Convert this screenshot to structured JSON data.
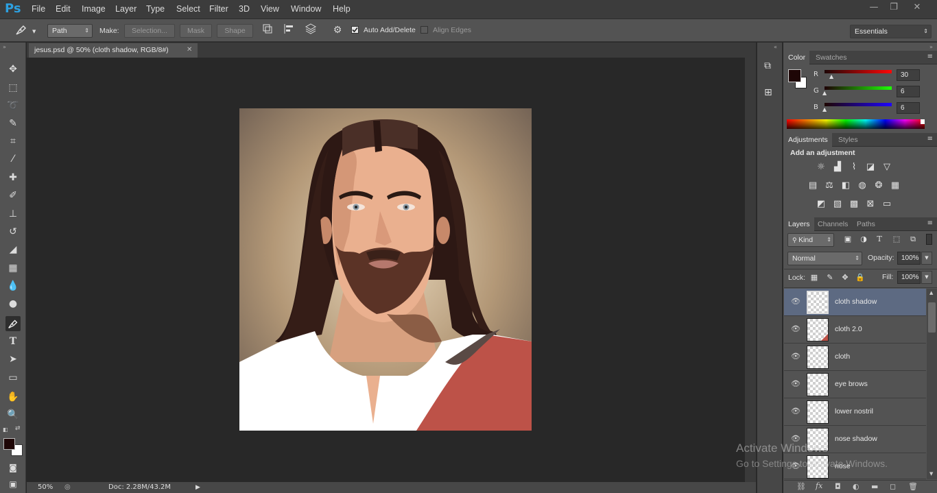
{
  "app": {
    "logo": "Ps"
  },
  "menu": [
    "File",
    "Edit",
    "Image",
    "Layer",
    "Type",
    "Select",
    "Filter",
    "3D",
    "View",
    "Window",
    "Help"
  ],
  "window_controls": {
    "minimize": "—",
    "restore": "❐",
    "close": "✕"
  },
  "options": {
    "mode": "Path",
    "make_label": "Make:",
    "selection": "Selection...",
    "mask": "Mask",
    "shape": "Shape",
    "auto_add_delete": "Auto Add/Delete",
    "align_edges": "Align Edges",
    "workspace": "Essentials"
  },
  "document": {
    "tab_title": "jesus.psd @ 50% (cloth shadow, RGB/8#)",
    "zoom": "50%",
    "doc_size": "Doc: 2.28M/43.2M"
  },
  "color_panel": {
    "tabs": [
      "Color",
      "Swatches"
    ],
    "r_label": "R",
    "g_label": "G",
    "b_label": "B",
    "r": "30",
    "g": "6",
    "b": "6",
    "foreground": "#1e0606",
    "background": "#ffffff"
  },
  "adjustments_panel": {
    "tabs": [
      "Adjustments",
      "Styles"
    ],
    "heading": "Add an adjustment"
  },
  "layers_panel": {
    "tabs": [
      "Layers",
      "Channels",
      "Paths"
    ],
    "filter_kind": "Kind",
    "blend_mode": "Normal",
    "opacity_label": "Opacity:",
    "opacity": "100%",
    "lock_label": "Lock:",
    "fill_label": "Fill:",
    "fill": "100%",
    "layers": [
      {
        "name": "cloth shadow",
        "selected": true
      },
      {
        "name": "cloth 2.0",
        "selected": false
      },
      {
        "name": "cloth",
        "selected": false
      },
      {
        "name": "eye brows",
        "selected": false
      },
      {
        "name": "lower nostril",
        "selected": false
      },
      {
        "name": "nose shadow",
        "selected": false
      },
      {
        "name": "nose",
        "selected": false
      }
    ]
  },
  "watermark": {
    "line1": "Activate Windows",
    "line2": "Go to Settings to activate Windows."
  }
}
